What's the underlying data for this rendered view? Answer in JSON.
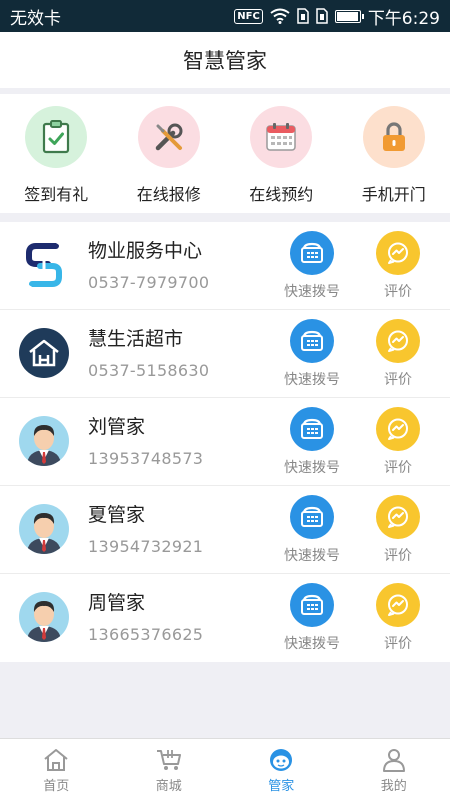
{
  "status_bar": {
    "carrier": "无效卡",
    "nfc": "NFC",
    "time": "下午6:29"
  },
  "header": {
    "title": "智慧管家"
  },
  "quick_actions": [
    {
      "label": "签到有礼",
      "icon": "clipboard-check-icon",
      "color": "#d6f2dc"
    },
    {
      "label": "在线报修",
      "icon": "tools-icon",
      "color": "#fbdde2"
    },
    {
      "label": "在线预约",
      "icon": "calendar-icon",
      "color": "#fbdde2"
    },
    {
      "label": "手机开门",
      "icon": "lock-icon",
      "color": "#fde0cc"
    }
  ],
  "contacts": [
    {
      "name": "物业服务中心",
      "phone": "0537-7979700",
      "avatar": "property-logo"
    },
    {
      "name": "慧生活超市",
      "phone": "0537-5158630",
      "avatar": "house-logo"
    },
    {
      "name": "刘管家",
      "phone": "13953748573",
      "avatar": "man-avatar"
    },
    {
      "name": "夏管家",
      "phone": "13954732921",
      "avatar": "man-avatar"
    },
    {
      "name": "周管家",
      "phone": "13665376625",
      "avatar": "man-avatar"
    }
  ],
  "actions": {
    "dial_label": "快速拨号",
    "rate_label": "评价"
  },
  "tabbar": [
    {
      "label": "首页",
      "icon": "home-icon",
      "active": false
    },
    {
      "label": "商城",
      "icon": "cart-icon",
      "active": false
    },
    {
      "label": "管家",
      "icon": "butler-icon",
      "active": true
    },
    {
      "label": "我的",
      "icon": "user-icon",
      "active": false
    }
  ],
  "colors": {
    "accent": "#2a92e4",
    "rate": "#f8c62e",
    "status_bar": "#112a38"
  }
}
